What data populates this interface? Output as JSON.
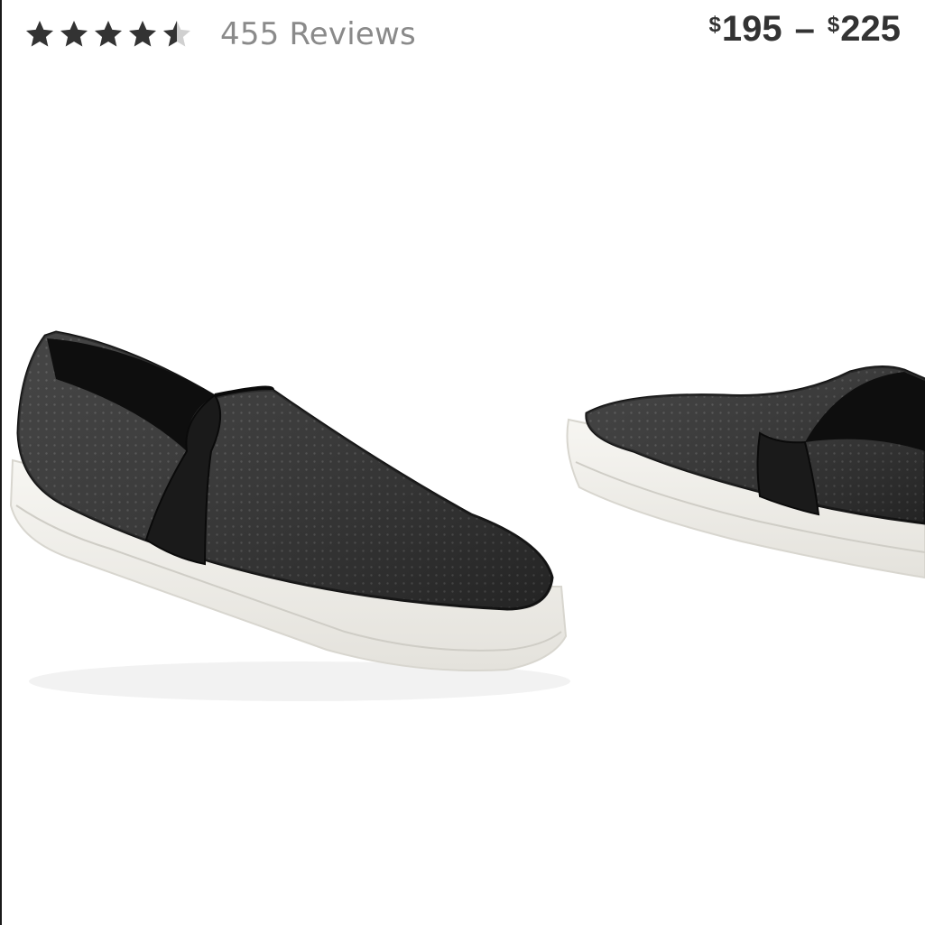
{
  "rating": {
    "value": 4.5,
    "max": 5,
    "reviews_label": "455 Reviews",
    "star_color": "#333333",
    "empty_star_color": "#d0d0d0"
  },
  "price": {
    "currency": "$",
    "low": "195",
    "separator": "–",
    "high": "225"
  },
  "gallery": {
    "images": [
      {
        "name": "product-image-main",
        "alt": "black perforated slip-on sneaker"
      },
      {
        "name": "product-image-secondary",
        "alt": "black perforated slip-on sneaker side view"
      }
    ]
  }
}
